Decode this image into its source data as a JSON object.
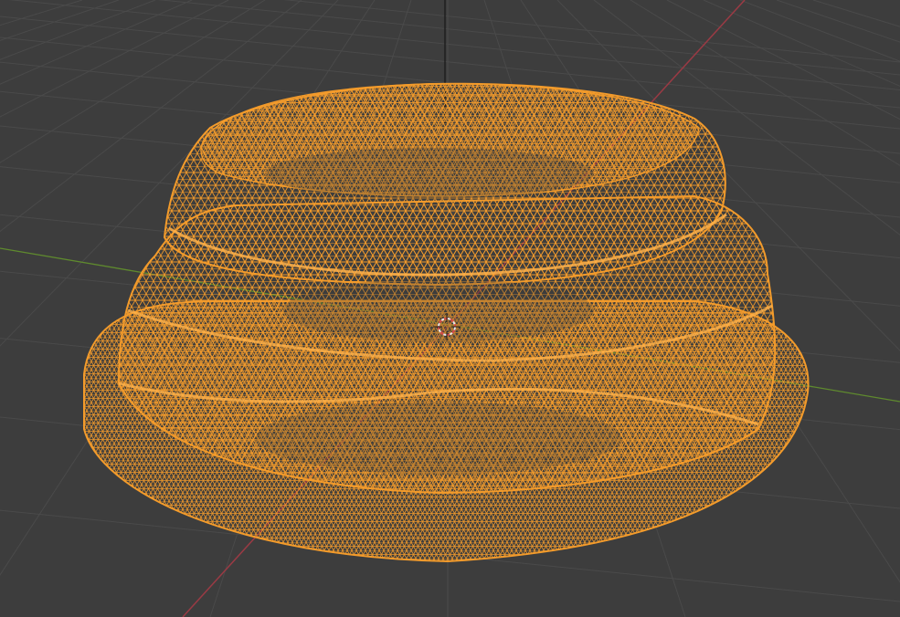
{
  "viewport": {
    "mode": "wireframe",
    "selected_object": true
  },
  "colors": {
    "background": "#3d3d3d",
    "grid_line": "#4a4a4a",
    "x_axis": "#9a3a44",
    "y_axis": "#5f8a2e",
    "z_axis": "#1a1a1a",
    "wire_selected": "#f39b2b",
    "wire_dark": "#c87a1c",
    "cursor_red": "#e8e8e8",
    "cursor_white": "#d84848"
  },
  "icons": {
    "cursor": "3d-cursor-icon"
  }
}
